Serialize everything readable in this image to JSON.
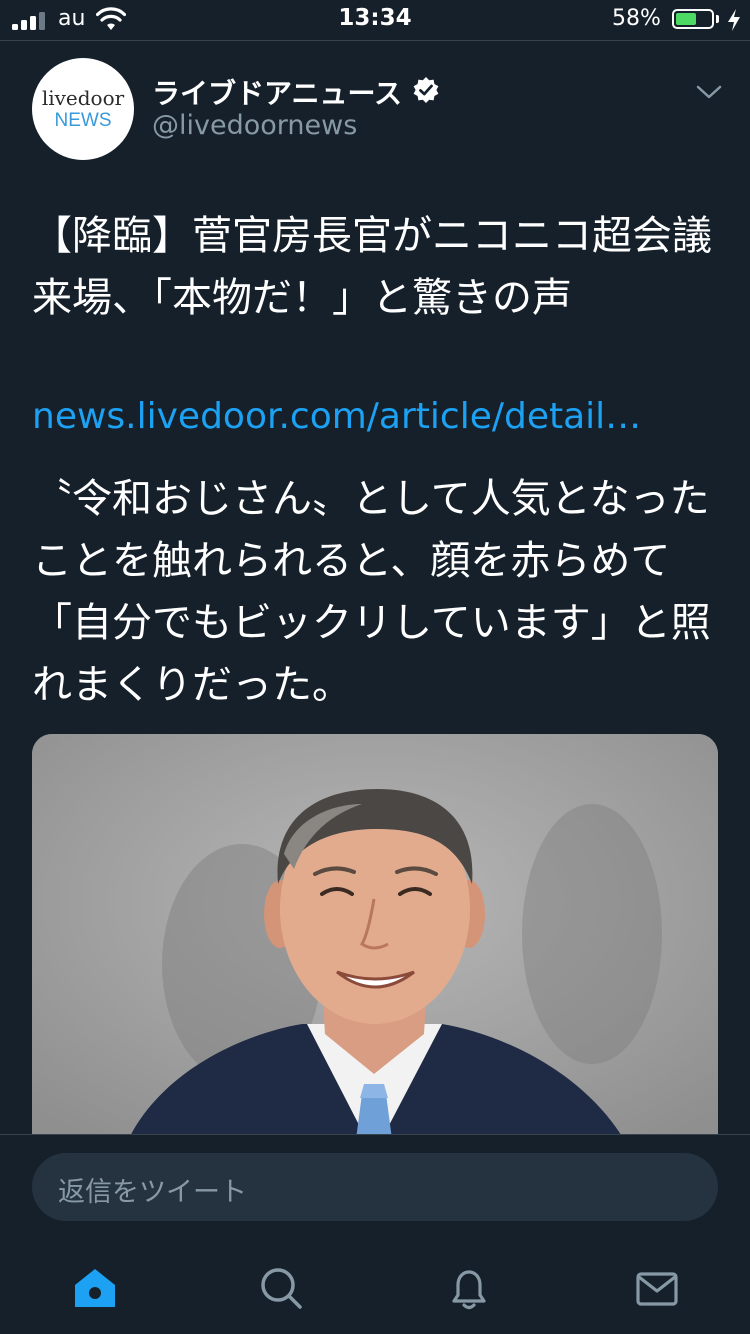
{
  "status_bar": {
    "carrier": "au",
    "time": "13:34",
    "battery_percent_label": "58%",
    "battery_level": 0.58,
    "battery_color": "#4cd964"
  },
  "tweet": {
    "author": {
      "display_name": "ライブドアニュース",
      "handle": "@livedoornews",
      "avatar_text_top": "livedoor",
      "avatar_text_bottom": "NEWS",
      "verified": true
    },
    "headline": "【降臨】菅官房長官がニコニコ超会議来場、「本物だ！」と驚きの声",
    "link": "news.livedoor.com/article/detail…",
    "body": "〝令和おじさん〟として人気となったことを触れられると、顔を赤らめて「自分でもビックリしています」と照れまくりだった。",
    "media": {
      "icon": "photo"
    }
  },
  "reply": {
    "placeholder": "返信をツイート"
  },
  "tabbar": {
    "items": [
      {
        "icon": "home-icon",
        "active": true
      },
      {
        "icon": "search-icon",
        "active": false
      },
      {
        "icon": "bell-icon",
        "active": false
      },
      {
        "icon": "mail-icon",
        "active": false
      }
    ]
  },
  "colors": {
    "background": "#15202b",
    "accent": "#1da1f2",
    "secondary_text": "#8899a6",
    "divider": "#38444d"
  }
}
